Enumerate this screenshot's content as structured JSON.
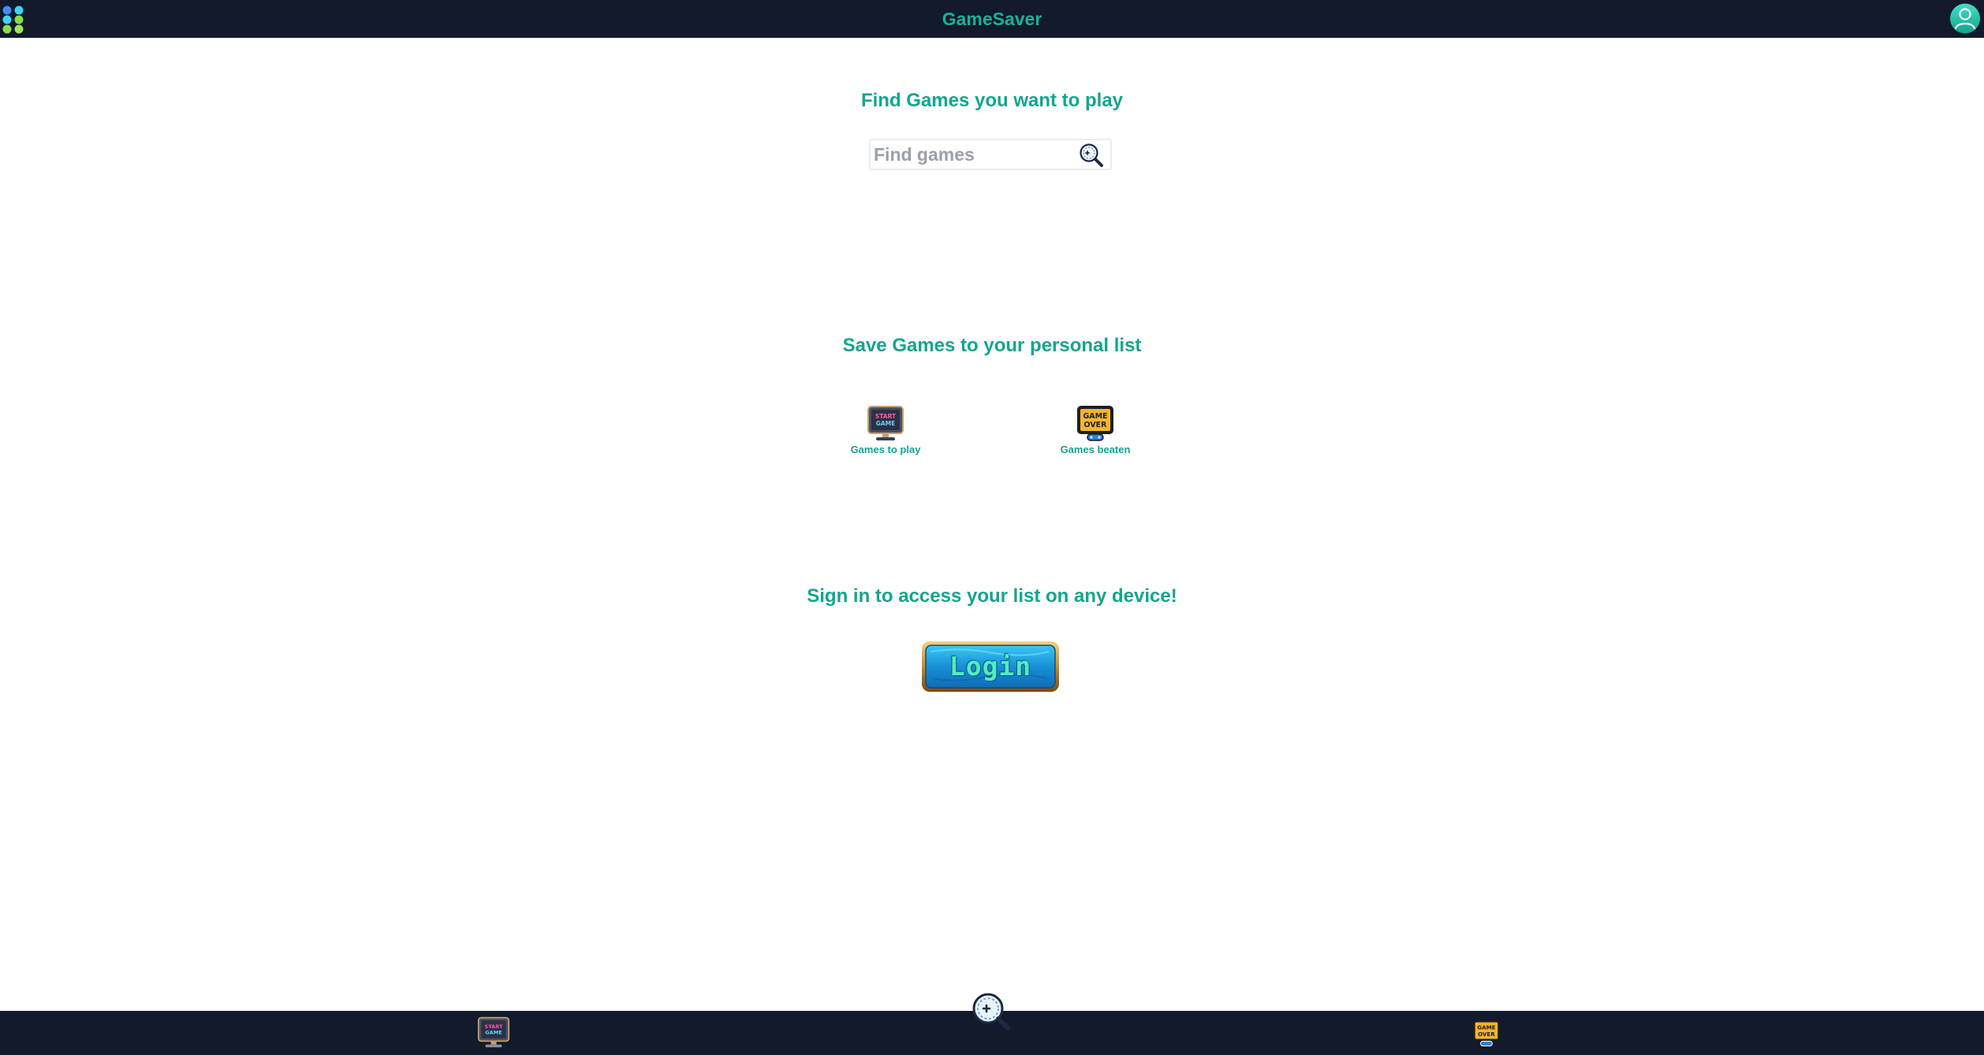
{
  "header": {
    "title": "GameSaver",
    "menu_icon": "app-grid-icon",
    "profile_icon": "user-icon"
  },
  "search_section": {
    "heading": "Find Games you want to play",
    "placeholder": "Find games",
    "value": "",
    "button_icon": "magnifier-icon"
  },
  "lists_section": {
    "heading": "Save Games to your personal list",
    "items": [
      {
        "label": "Games to play",
        "icon": "start-game-icon",
        "icon_text": [
          "START",
          "GAME"
        ]
      },
      {
        "label": "Games beaten",
        "icon": "game-over-icon",
        "icon_text": [
          "GAME",
          "OVER"
        ]
      }
    ]
  },
  "signin_section": {
    "heading": "Sign in to access your list on any device!",
    "login_label": "Login"
  },
  "bottom_nav": {
    "items": [
      {
        "name": "games-to-play",
        "icon": "start-game-icon"
      },
      {
        "name": "search",
        "icon": "magnifier-icon"
      },
      {
        "name": "games-beaten",
        "icon": "game-over-icon"
      }
    ]
  },
  "colors": {
    "bar_background": "#121a2b",
    "accent": "#14a58f",
    "title": "#17b29a"
  }
}
